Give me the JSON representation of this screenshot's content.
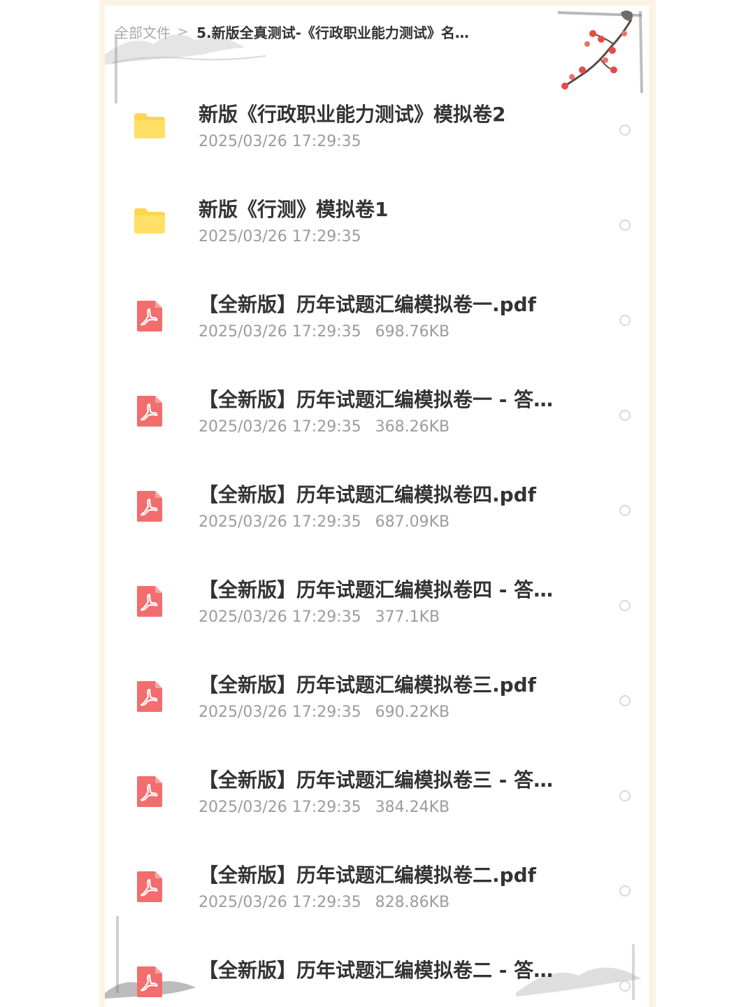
{
  "breadcrumb": {
    "root": "全部文件",
    "separator": ">",
    "current": "5.新版全真测试-《行政职业能力测试》名…"
  },
  "colors": {
    "folder": "#ffd54f",
    "pdf": "#f26d6d",
    "frame": "#fbf3e6"
  },
  "files": [
    {
      "name": "新版《行政职业能力测试》模拟卷2",
      "date": "2025/03/26 17:29:35",
      "size": "",
      "icon": "folder-icon"
    },
    {
      "name": "新版《行测》模拟卷1",
      "date": "2025/03/26 17:29:35",
      "size": "",
      "icon": "folder-icon"
    },
    {
      "name": "【全新版】历年试题汇编模拟卷一.pdf",
      "date": "2025/03/26 17:29:35",
      "size": "698.76KB",
      "icon": "pdf-icon"
    },
    {
      "name": "【全新版】历年试题汇编模拟卷一 - 答…",
      "date": "2025/03/26 17:29:35",
      "size": "368.26KB",
      "icon": "pdf-icon"
    },
    {
      "name": "【全新版】历年试题汇编模拟卷四.pdf",
      "date": "2025/03/26 17:29:35",
      "size": "687.09KB",
      "icon": "pdf-icon"
    },
    {
      "name": "【全新版】历年试题汇编模拟卷四 - 答…",
      "date": "2025/03/26 17:29:35",
      "size": "377.1KB",
      "icon": "pdf-icon"
    },
    {
      "name": "【全新版】历年试题汇编模拟卷三.pdf",
      "date": "2025/03/26 17:29:35",
      "size": "690.22KB",
      "icon": "pdf-icon"
    },
    {
      "name": "【全新版】历年试题汇编模拟卷三 - 答…",
      "date": "2025/03/26 17:29:35",
      "size": "384.24KB",
      "icon": "pdf-icon"
    },
    {
      "name": "【全新版】历年试题汇编模拟卷二.pdf",
      "date": "2025/03/26 17:29:35",
      "size": "828.86KB",
      "icon": "pdf-icon"
    },
    {
      "name": "【全新版】历年试题汇编模拟卷二 - 答…",
      "date": "",
      "size": "",
      "icon": "pdf-icon"
    }
  ]
}
